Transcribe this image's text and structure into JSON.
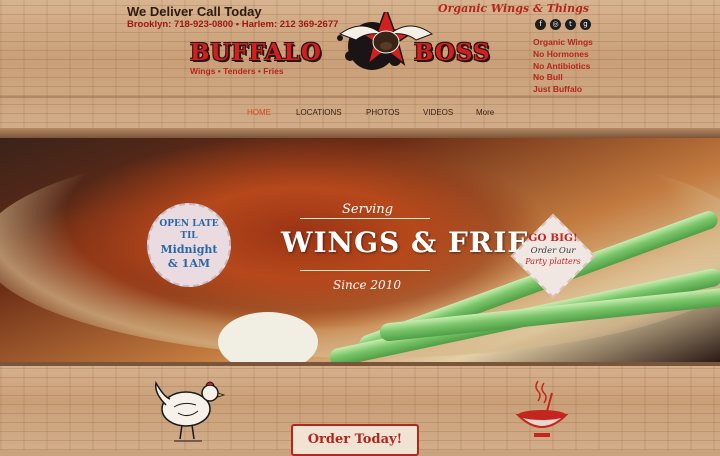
{
  "header": {
    "deliver": "We Deliver Call Today",
    "phones": "Brooklyn: 718-923-0800  •  Harlem: 212 369-2677",
    "tagline": "Organic Wings & Things",
    "logo_left": "BUFFALO",
    "logo_right": "BOSS",
    "sub_tagline": "Wings • Tenders • Fries",
    "features": [
      "Organic Wings",
      "No Hormones",
      "No Antibiotics",
      "No Bull",
      "Just Buffalo"
    ],
    "social": [
      {
        "icon": "facebook-icon",
        "glyph": "f"
      },
      {
        "icon": "instagram-icon",
        "glyph": "◎"
      },
      {
        "icon": "twitter-icon",
        "glyph": "t"
      },
      {
        "icon": "googleplus-icon",
        "glyph": "g"
      }
    ]
  },
  "nav": {
    "items": [
      "HOME",
      "LOCATIONS",
      "PHOTOS",
      "VIDEOS",
      "More"
    ],
    "active": "HOME"
  },
  "hero": {
    "serving": "Serving",
    "title": "WINGS & FRIES",
    "since": "Since 2010",
    "badge_late": [
      "OPEN LATE",
      "TIL",
      "Midnight",
      "& 1AM"
    ],
    "badge_big": [
      "GO BIG!",
      "Order Our",
      "Party platters"
    ]
  },
  "footer": {
    "order_button": "Order Today!"
  },
  "colors": {
    "brand_red": "#b3261b",
    "nav_active": "#d24a1f",
    "badge_blue": "#2a67a9"
  }
}
